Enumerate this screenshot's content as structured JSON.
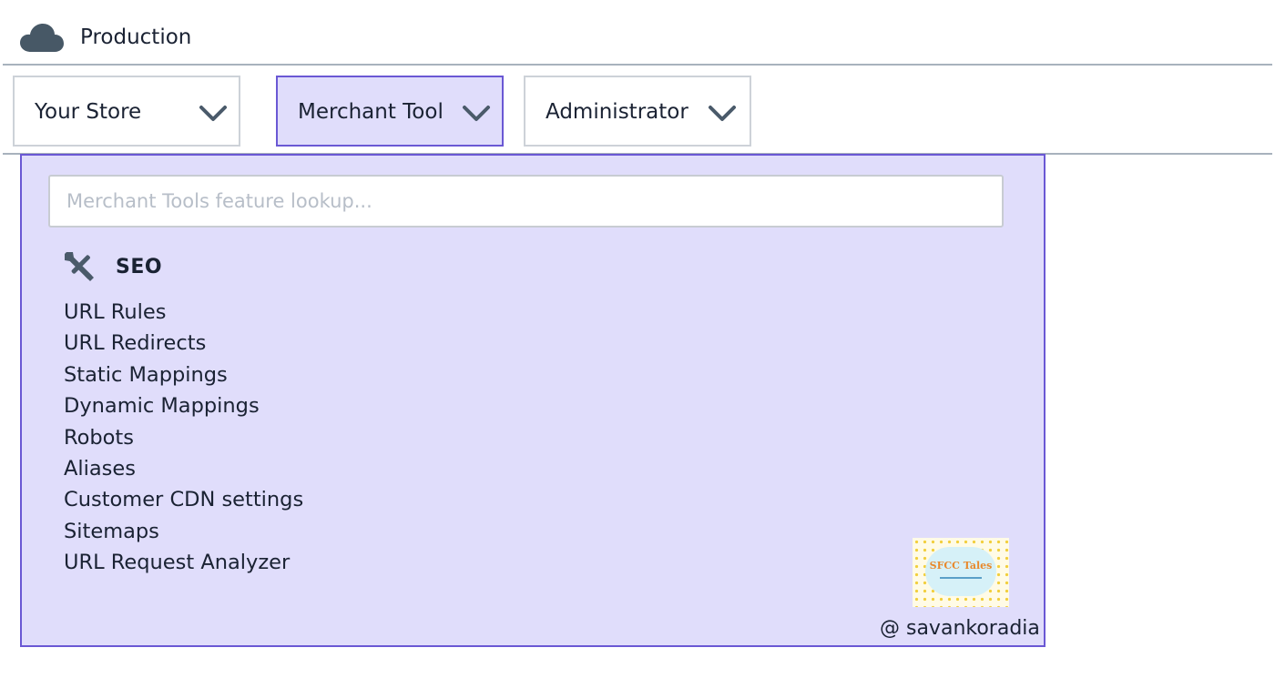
{
  "environment": {
    "label": "Production",
    "icon": "cloud-icon",
    "icon_color": "#475866"
  },
  "nav": {
    "tabs": [
      {
        "label": "Your Store",
        "active": false
      },
      {
        "label": "Merchant Tool",
        "active": true
      },
      {
        "label": "Administrator",
        "active": false
      }
    ]
  },
  "menu": {
    "search_placeholder": "Merchant Tools feature lookup...",
    "search_value": "",
    "section": {
      "title": "SEO",
      "icon": "tools-icon"
    },
    "items": [
      "URL Rules",
      "URL Redirects",
      "Static Mappings",
      "Dynamic Mappings",
      "Robots",
      "Aliases",
      "Customer CDN settings",
      "Sitemaps",
      "URL Request Analyzer"
    ]
  },
  "watermark": {
    "logo_text": "SFCC Tales",
    "credit": "@ savankoradia"
  },
  "colors": {
    "accent": "#6a58d4",
    "panel_bg": "#e0ddfb",
    "text": "#1a2233"
  }
}
